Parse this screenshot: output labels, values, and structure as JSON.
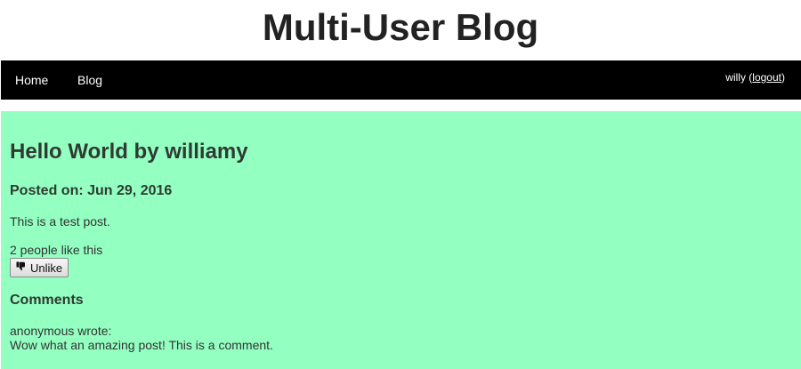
{
  "site": {
    "title": "Multi-User Blog"
  },
  "nav": {
    "home_label": "Home",
    "blog_label": "Blog",
    "username": "willy",
    "logout_label": "logout"
  },
  "post": {
    "title": "Hello World by williamy",
    "posted_on": "Posted on: Jun 29, 2016",
    "body": "This is a test post.",
    "like_count_text": "2 people like this",
    "unlike_label": "Unlike",
    "unlike_icon": "thumbs-down-icon",
    "background_color": "#93ffc1"
  },
  "comments": {
    "heading": "Comments",
    "items": [
      {
        "author_line": "anonymous wrote:",
        "text": "Wow what an amazing post! This is a comment."
      }
    ]
  }
}
